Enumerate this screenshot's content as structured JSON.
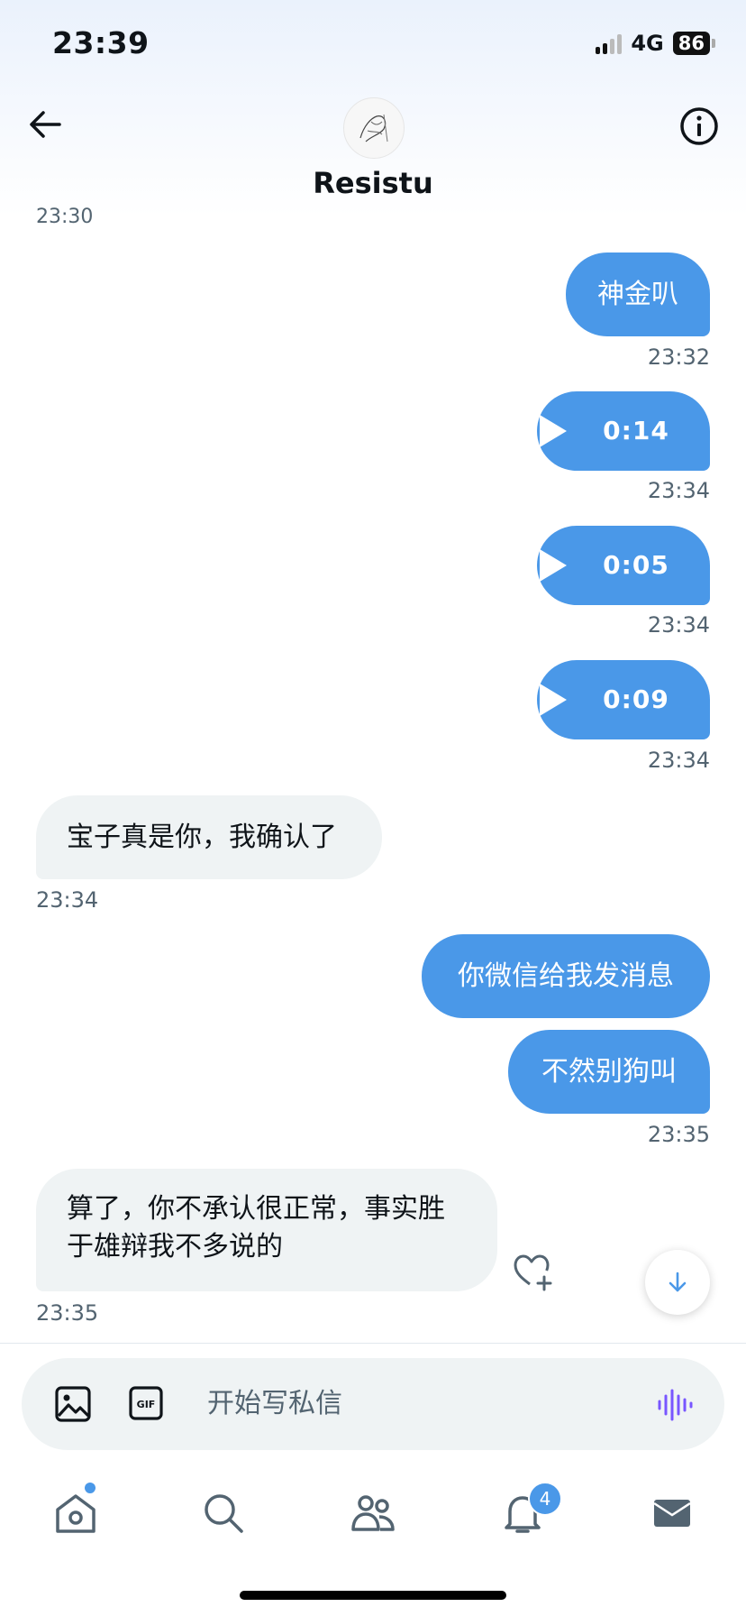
{
  "status_bar": {
    "time": "23:39",
    "network": "4G",
    "battery": "86"
  },
  "header": {
    "title": "Resistu",
    "clipped_time": "23:30"
  },
  "messages": [
    {
      "side": "out",
      "kind": "text",
      "text": "神金叭",
      "time": "23:32"
    },
    {
      "side": "out",
      "kind": "voice",
      "duration": "0:14",
      "time": "23:34"
    },
    {
      "side": "out",
      "kind": "voice",
      "duration": "0:05",
      "time": "23:34"
    },
    {
      "side": "out",
      "kind": "voice",
      "duration": "0:09",
      "time": "23:34"
    },
    {
      "side": "in",
      "kind": "text",
      "text": "宝子真是你，我确认了",
      "time": "23:34"
    },
    {
      "side": "out",
      "kind": "text",
      "text": "你微信给我发消息"
    },
    {
      "side": "out",
      "kind": "text",
      "text": "不然别狗叫",
      "time": "23:35"
    },
    {
      "side": "in",
      "kind": "text",
      "text_lines": [
        "算了，你不承认很正常，事实胜",
        "于雄辩我不多说的"
      ],
      "time": "23:35"
    }
  ],
  "composer": {
    "placeholder": "开始写私信"
  },
  "tabbar": {
    "notifications_badge": "4"
  },
  "colors": {
    "accent": "#4a98e8",
    "incoming_bubble": "#eff3f4",
    "voice_icon": "#7856ff"
  }
}
